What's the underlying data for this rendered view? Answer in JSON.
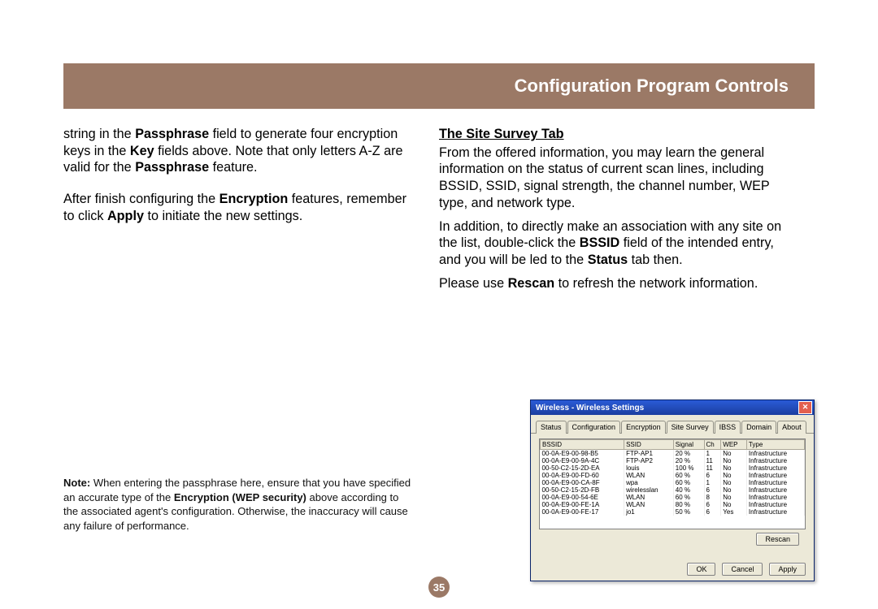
{
  "header": {
    "title": "Configuration Program Controls"
  },
  "page_number": "35",
  "left": {
    "p1a": "string in the ",
    "p1b_bold": "Passphrase",
    "p1c": " field to generate four encryption keys in the ",
    "p1d_bold": "Key",
    "p1e": " fields above. Note that only letters A-Z are valid for the ",
    "p1f_bold": "Passphrase",
    "p1g": " feature.",
    "p2a": "After finish configuring the ",
    "p2b_bold": "Encryption",
    "p2c": " features, remember to click ",
    "p2d_bold": "Apply",
    "p2e": " to initiate the new settings."
  },
  "note": {
    "lead_bold": "Note:",
    "t1": " When entering the passphrase here, ensure that you have specified an accurate type of the ",
    "t2_bold": "Encryption (WEP security)",
    "t3": " above according to the associated agent's configuration. Otherwise, the inaccuracy will cause any failure of performance."
  },
  "right": {
    "heading": "The Site Survey Tab",
    "p1": "From the offered information, you may learn the general information on the status of current scan lines, including BSSID, SSID, signal strength, the channel number, WEP type, and network type.",
    "p2a": "In addition, to directly make an association with any site on the list, double-click the ",
    "p2b_bold": "BSSID",
    "p2c": " field of the intended entry, and you will be led to the ",
    "p2d_bold": "Status",
    "p2e": " tab then.",
    "p3a": "Please use ",
    "p3b_bold": "Rescan",
    "p3c": " to refresh the network information."
  },
  "dialog": {
    "title": "Wireless - Wireless Settings",
    "tabs": [
      "Status",
      "Configuration",
      "Encryption",
      "Site Survey",
      "IBSS",
      "Domain",
      "About"
    ],
    "active_tab": 3,
    "columns": [
      "BSSID",
      "SSID",
      "Signal",
      "Ch",
      "WEP",
      "Type"
    ],
    "rows": [
      [
        "00-0A-E9-00-98-B5",
        "FTP-AP1",
        "20 %",
        "1",
        "No",
        "Infrastructure"
      ],
      [
        "00-0A-E9-00-9A-4C",
        "FTP-AP2",
        "20 %",
        "11",
        "No",
        "Infrastructure"
      ],
      [
        "00-50-C2-15-2D-EA",
        "louis",
        "100 %",
        "11",
        "No",
        "Infrastructure"
      ],
      [
        "00-0A-E9-00-FD-60",
        "WLAN",
        "60 %",
        "6",
        "No",
        "Infrastructure"
      ],
      [
        "00-0A-E9-00-CA-8F",
        "wpa",
        "60 %",
        "1",
        "No",
        "Infrastructure"
      ],
      [
        "00-50-C2-15-2D-FB",
        "wirelesslan",
        "40 %",
        "6",
        "No",
        "Infrastructure"
      ],
      [
        "00-0A-E9-00-54-6E",
        "WLAN",
        "60 %",
        "8",
        "No",
        "Infrastructure"
      ],
      [
        "00-0A-E9-00-FE-1A",
        "WLAN",
        "80 %",
        "6",
        "No",
        "Infrastructure"
      ],
      [
        "00-0A-E9-00-FE-17",
        "jo1",
        "50 %",
        "6",
        "Yes",
        "Infrastructure"
      ]
    ],
    "buttons": {
      "rescan": "Rescan",
      "ok": "OK",
      "cancel": "Cancel",
      "apply": "Apply"
    }
  }
}
